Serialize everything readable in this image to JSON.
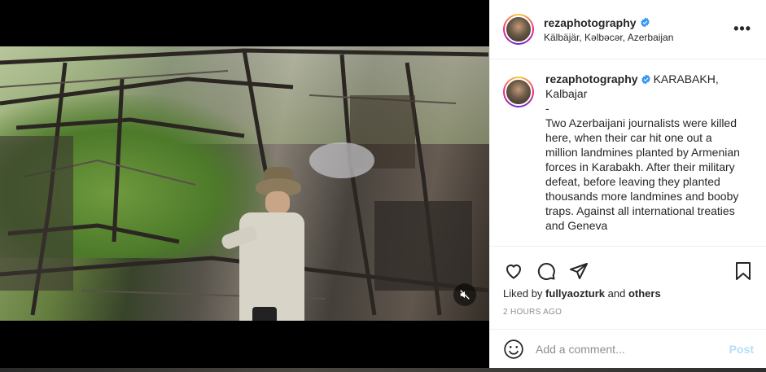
{
  "post": {
    "username": "rezaphotography",
    "location": "Kälbäjär, Kəlbəcər, Azerbaijan",
    "more_icon": "more-horizontal-icon",
    "caption_prefix": "KARABAKH, Kalbajar",
    "caption_dash": "-",
    "caption_text": "Two Azerbaijani journalists were killed here, when their car hit one out a million landmines planted by Armenian forces in Karabakh. After their military defeat, before leaving they planted thousands more landmines and booby traps. Against all international treaties and Geneva",
    "liked_by_prefix": "Liked by",
    "liked_by_user": "fullyaozturk",
    "liked_by_and": "and",
    "liked_by_others": "others",
    "timestamp": "2 HOURS AGO",
    "comment_placeholder": "Add a comment...",
    "post_button": "Post"
  },
  "colors": {
    "verified": "#3897f0",
    "post_disabled": "#b2dffc",
    "text": "#262626",
    "muted": "#8e8e8e"
  },
  "icons": [
    "heart-icon",
    "comment-icon",
    "share-icon",
    "bookmark-icon",
    "emoji-icon",
    "muted-speaker-icon",
    "verified-badge-icon"
  ]
}
